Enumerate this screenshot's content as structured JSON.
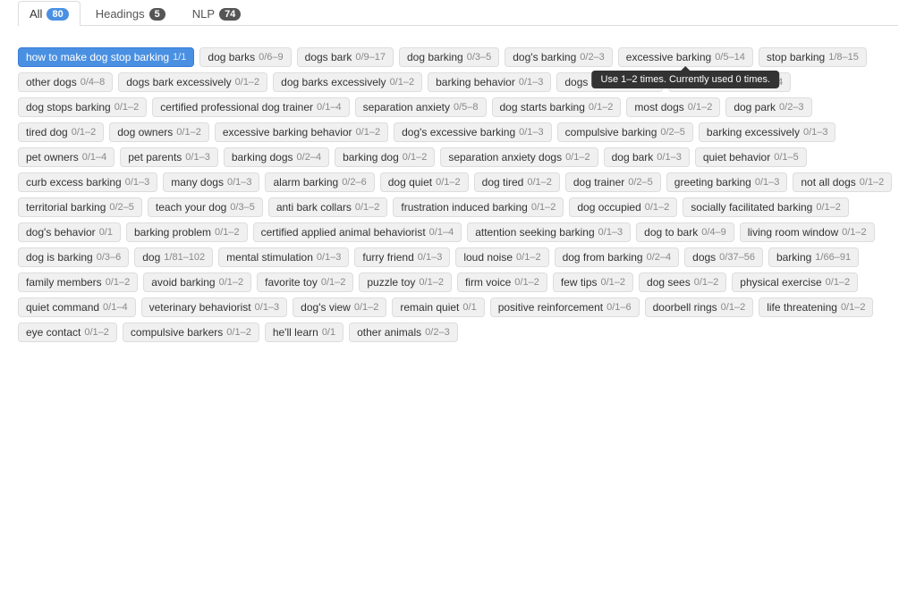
{
  "tabs": [
    {
      "id": "all",
      "label": "All",
      "count": "80",
      "active": true
    },
    {
      "id": "headings",
      "label": "Headings",
      "count": "5",
      "active": false
    },
    {
      "id": "nlp",
      "label": "NLP",
      "count": "74",
      "active": false
    }
  ],
  "tooltip": "Use 1–2 times. Currently used 0 times.",
  "tags": [
    {
      "text": "how to make dog stop barking",
      "count": "1/1",
      "selected": true
    },
    {
      "text": "dog barks",
      "count": "0/6–9"
    },
    {
      "text": "dogs bark",
      "count": "0/9–17"
    },
    {
      "text": "dog barking",
      "count": "0/3–5"
    },
    {
      "text": "dog's barking",
      "count": "0/2–3"
    },
    {
      "text": "excessive barking",
      "count": "0/5–14",
      "tooltip": true
    },
    {
      "text": "stop barking",
      "count": "1/8–15"
    },
    {
      "text": "other dogs",
      "count": "0/4–8"
    },
    {
      "text": "dogs bark excessively",
      "count": "0/1–2"
    },
    {
      "text": "dog barks excessively",
      "count": "0/1–2"
    },
    {
      "text": "barking behavior",
      "count": "0/1–3"
    },
    {
      "text": "dogs barking",
      "count": "0/2–4"
    },
    {
      "text": "bark excessively",
      "count": "0/3–4"
    },
    {
      "text": "dog stops barking",
      "count": "0/1–2"
    },
    {
      "text": "certified professional dog trainer",
      "count": "0/1–4"
    },
    {
      "text": "separation anxiety",
      "count": "0/5–8"
    },
    {
      "text": "dog starts barking",
      "count": "0/1–2"
    },
    {
      "text": "most dogs",
      "count": "0/1–2"
    },
    {
      "text": "dog park",
      "count": "0/2–3"
    },
    {
      "text": "tired dog",
      "count": "0/1–2"
    },
    {
      "text": "dog owners",
      "count": "0/1–2"
    },
    {
      "text": "excessive barking behavior",
      "count": "0/1–2"
    },
    {
      "text": "dog's excessive barking",
      "count": "0/1–3"
    },
    {
      "text": "compulsive barking",
      "count": "0/2–5"
    },
    {
      "text": "barking excessively",
      "count": "0/1–3"
    },
    {
      "text": "pet owners",
      "count": "0/1–4"
    },
    {
      "text": "pet parents",
      "count": "0/1–3"
    },
    {
      "text": "barking dogs",
      "count": "0/2–4"
    },
    {
      "text": "barking dog",
      "count": "0/1–2"
    },
    {
      "text": "separation anxiety dogs",
      "count": "0/1–2"
    },
    {
      "text": "dog bark",
      "count": "0/1–3"
    },
    {
      "text": "quiet behavior",
      "count": "0/1–5"
    },
    {
      "text": "curb excess barking",
      "count": "0/1–3"
    },
    {
      "text": "many dogs",
      "count": "0/1–3"
    },
    {
      "text": "alarm barking",
      "count": "0/2–6"
    },
    {
      "text": "dog quiet",
      "count": "0/1–2"
    },
    {
      "text": "dog tired",
      "count": "0/1–2"
    },
    {
      "text": "dog trainer",
      "count": "0/2–5"
    },
    {
      "text": "greeting barking",
      "count": "0/1–3"
    },
    {
      "text": "not all dogs",
      "count": "0/1–2"
    },
    {
      "text": "territorial barking",
      "count": "0/2–5"
    },
    {
      "text": "teach your dog",
      "count": "0/3–5"
    },
    {
      "text": "anti bark collars",
      "count": "0/1–2"
    },
    {
      "text": "frustration induced barking",
      "count": "0/1–2"
    },
    {
      "text": "dog occupied",
      "count": "0/1–2"
    },
    {
      "text": "socially facilitated barking",
      "count": "0/1–2"
    },
    {
      "text": "dog's behavior",
      "count": "0/1"
    },
    {
      "text": "barking problem",
      "count": "0/1–2"
    },
    {
      "text": "certified applied animal behaviorist",
      "count": "0/1–4"
    },
    {
      "text": "attention seeking barking",
      "count": "0/1–3"
    },
    {
      "text": "dog to bark",
      "count": "0/4–9"
    },
    {
      "text": "living room window",
      "count": "0/1–2"
    },
    {
      "text": "dog is barking",
      "count": "0/3–6"
    },
    {
      "text": "dog",
      "count": "1/81–102"
    },
    {
      "text": "mental stimulation",
      "count": "0/1–3"
    },
    {
      "text": "furry friend",
      "count": "0/1–3"
    },
    {
      "text": "loud noise",
      "count": "0/1–2"
    },
    {
      "text": "dog from barking",
      "count": "0/2–4"
    },
    {
      "text": "dogs",
      "count": "0/37–56"
    },
    {
      "text": "barking",
      "count": "1/66–91"
    },
    {
      "text": "family members",
      "count": "0/1–2"
    },
    {
      "text": "avoid barking",
      "count": "0/1–2"
    },
    {
      "text": "favorite toy",
      "count": "0/1–2"
    },
    {
      "text": "puzzle toy",
      "count": "0/1–2"
    },
    {
      "text": "firm voice",
      "count": "0/1–2"
    },
    {
      "text": "few tips",
      "count": "0/1–2"
    },
    {
      "text": "dog sees",
      "count": "0/1–2"
    },
    {
      "text": "physical exercise",
      "count": "0/1–2"
    },
    {
      "text": "quiet command",
      "count": "0/1–4"
    },
    {
      "text": "veterinary behaviorist",
      "count": "0/1–3"
    },
    {
      "text": "dog's view",
      "count": "0/1–2"
    },
    {
      "text": "remain quiet",
      "count": "0/1"
    },
    {
      "text": "positive reinforcement",
      "count": "0/1–6"
    },
    {
      "text": "doorbell rings",
      "count": "0/1–2"
    },
    {
      "text": "life threatening",
      "count": "0/1–2"
    },
    {
      "text": "eye contact",
      "count": "0/1–2"
    },
    {
      "text": "compulsive barkers",
      "count": "0/1–2"
    },
    {
      "text": "he'll learn",
      "count": "0/1"
    },
    {
      "text": "other animals",
      "count": "0/2–3"
    }
  ]
}
